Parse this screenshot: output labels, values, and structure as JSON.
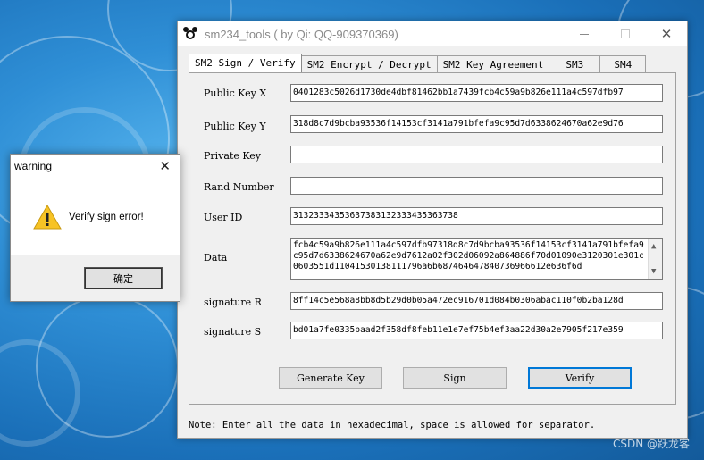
{
  "window": {
    "title": "sm234_tools ( by Qi: QQ-909370369)",
    "close_glyph": "✕"
  },
  "tabs": [
    {
      "label": "SM2 Sign / Verify",
      "active": true
    },
    {
      "label": "SM2 Encrypt / Decrypt",
      "active": false
    },
    {
      "label": "SM2 Key Agreement",
      "active": false
    },
    {
      "label": "SM3",
      "active": false
    },
    {
      "label": "SM4",
      "active": false
    }
  ],
  "form": {
    "public_key_x": {
      "label": "Public Key X",
      "value": "0401283c5026d1730de4dbf81462bb1a7439fcb4c59a9b826e111a4c597dfb97"
    },
    "public_key_y": {
      "label": "Public Key Y",
      "value": "318d8c7d9bcba93536f14153cf3141a791bfefa9c95d7d6338624670a62e9d76"
    },
    "private_key": {
      "label": "Private Key",
      "value": ""
    },
    "rand_number": {
      "label": "Rand Number",
      "value": ""
    },
    "user_id": {
      "label": "User ID",
      "value": "31323334353637383132333435363738"
    },
    "data": {
      "label": "Data",
      "value": "fcb4c59a9b826e111a4c597dfb97318d8c7d9bcba93536f14153cf3141a791bfefa9c95d7d6338624670a62e9d7612a02f302d06092a864886f70d01090e3120301e301c0603551d11041530138111796a6b687464647840736966612e636f6d"
    },
    "signature_r": {
      "label": "signature R",
      "value": "8ff14c5e568a8bb8d5b29d0b05a472ec916701d084b0306abac110f0b2ba128d"
    },
    "signature_s": {
      "label": "signature S",
      "value": "bd01a7fe0335baad2f358df8feb11e1e7ef75b4ef3aa22d30a2e7905f217e359"
    }
  },
  "buttons": {
    "generate_key": "Generate Key",
    "sign": "Sign",
    "verify": "Verify"
  },
  "note": "Note: Enter all the data in hexadecimal, space is allowed for separator.",
  "dialog": {
    "title": "warning",
    "close_glyph": "✕",
    "message": "Verify sign error!",
    "ok_label": "确定",
    "icon": "warning-triangle-icon"
  },
  "watermark": "CSDN @跃龙客"
}
